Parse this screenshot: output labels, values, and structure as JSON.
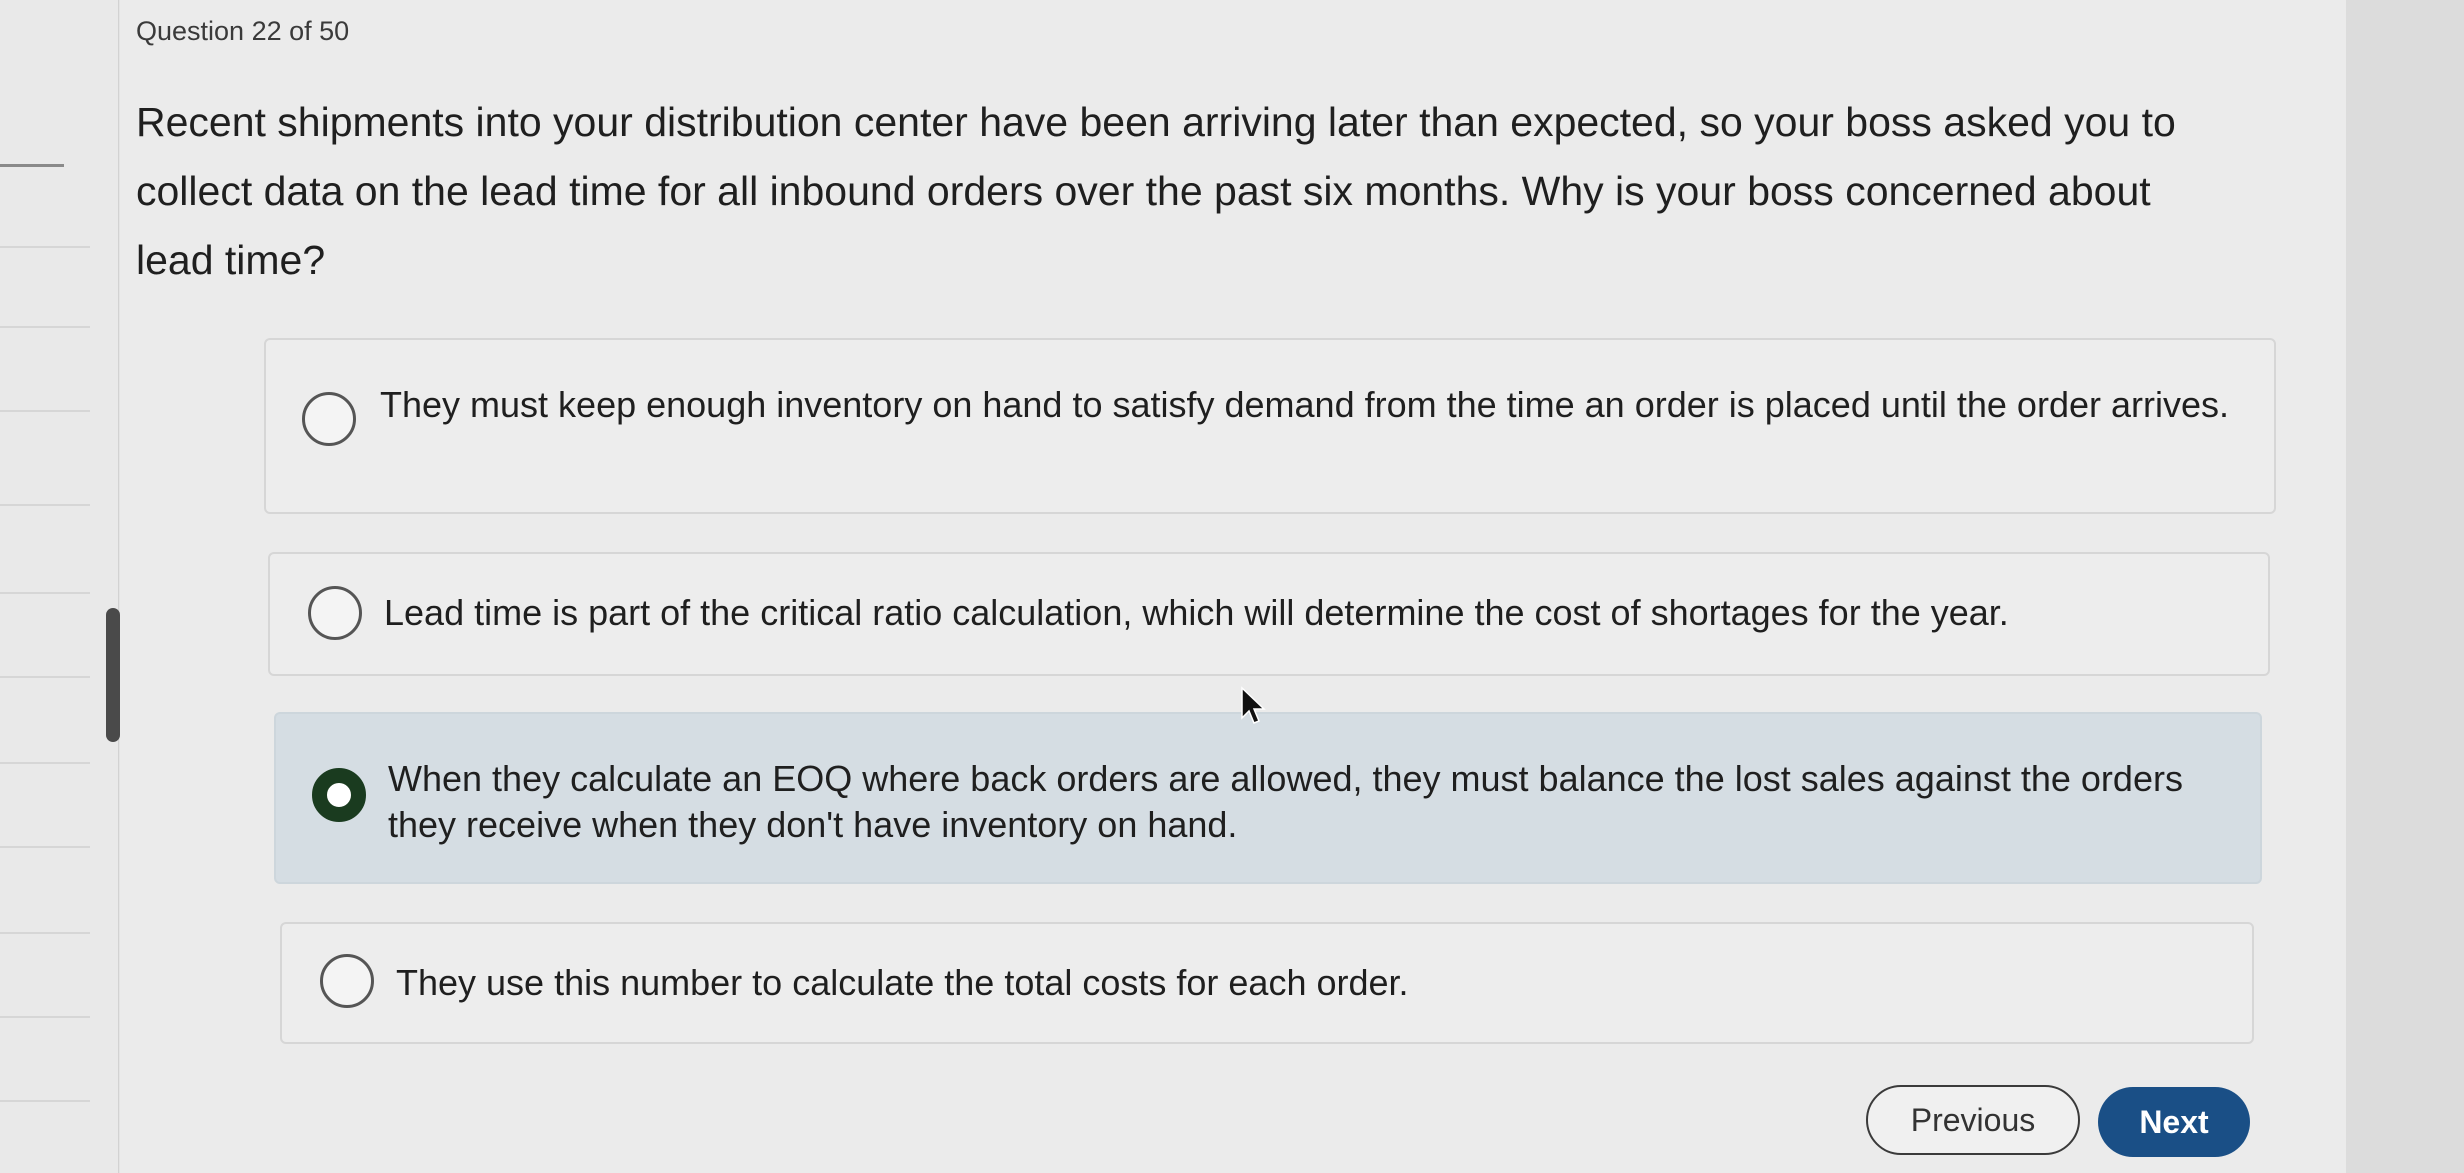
{
  "question": {
    "counter": "Question 22 of 50",
    "text": "Recent shipments into your distribution center have been arriving later than expected, so your boss asked you to collect data on the lead time for all inbound orders over the past six months. Why is your boss concerned about lead time?"
  },
  "options": [
    {
      "text": "They must keep enough inventory on hand to satisfy demand from the time an order is placed until the order arrives.",
      "selected": false
    },
    {
      "text": "Lead time is part of the critical ratio calculation, which will determine the cost of shortages for the year.",
      "selected": false
    },
    {
      "text": "When they calculate an EOQ where back orders are allowed, they must balance the lost sales against the orders they receive when they don't have inventory on hand.",
      "selected": true
    },
    {
      "text": "They use this number to calculate the total costs for each order.",
      "selected": false
    }
  ],
  "navigation": {
    "previous_label": "Previous",
    "next_label": "Next"
  },
  "colors": {
    "selected_background": "#d5dde3",
    "next_button": "#1a4f86",
    "radio_checked": "#1a3b1f"
  }
}
